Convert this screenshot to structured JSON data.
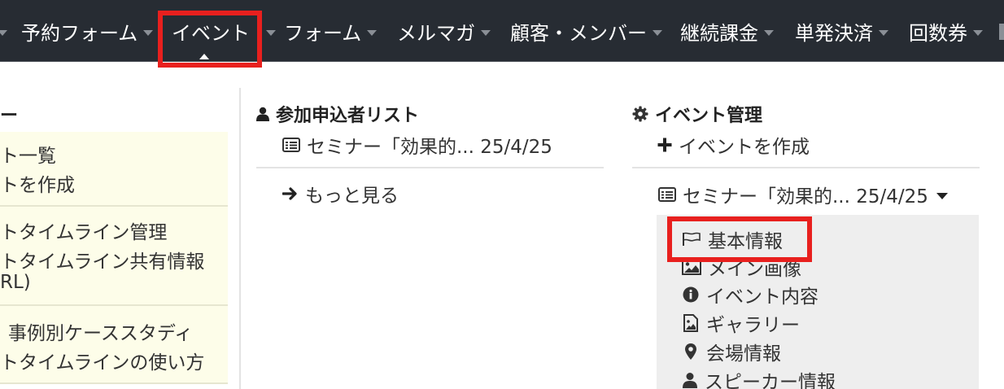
{
  "nav": {
    "items": [
      {
        "label": "予約フォーム"
      },
      {
        "label": "イベント"
      },
      {
        "label": "フォーム"
      },
      {
        "label": "メルマガ"
      },
      {
        "label": "顧客・メンバー"
      },
      {
        "label": "継続課金"
      },
      {
        "label": "単発決済"
      },
      {
        "label": "回数券"
      }
    ],
    "active_index": 1
  },
  "left": {
    "heading_tail": "ー",
    "groups": [
      [
        "ト一覧",
        "トを作成"
      ],
      [
        "トタイムライン管理",
        "トタイムライン共有情報",
        "RL)"
      ],
      [
        "事例別ケーススタディ",
        "トタイムラインの使い方"
      ]
    ]
  },
  "middle": {
    "heading": "参加申込者リスト",
    "event_item": "セミナー「効果的... 25/4/25",
    "more": "もっと見る"
  },
  "right": {
    "heading": "イベント管理",
    "create": "イベントを作成",
    "event_item": "セミナー「効果的... 25/4/25",
    "submenu": [
      {
        "label": "基本情報",
        "icon": "flag-icon"
      },
      {
        "label": "メイン画像",
        "icon": "picture-icon"
      },
      {
        "label": "イベント内容",
        "icon": "info-icon"
      },
      {
        "label": "ギャラリー",
        "icon": "image-file-icon"
      },
      {
        "label": "会場情報",
        "icon": "map-marker-icon"
      },
      {
        "label": "スピーカー情報",
        "icon": "user-icon"
      }
    ]
  },
  "colors": {
    "nav_bg": "#272c33",
    "highlight": "#e8201e",
    "left_card_bg": "#fdfde9",
    "submenu_bg": "#eeeeee"
  }
}
